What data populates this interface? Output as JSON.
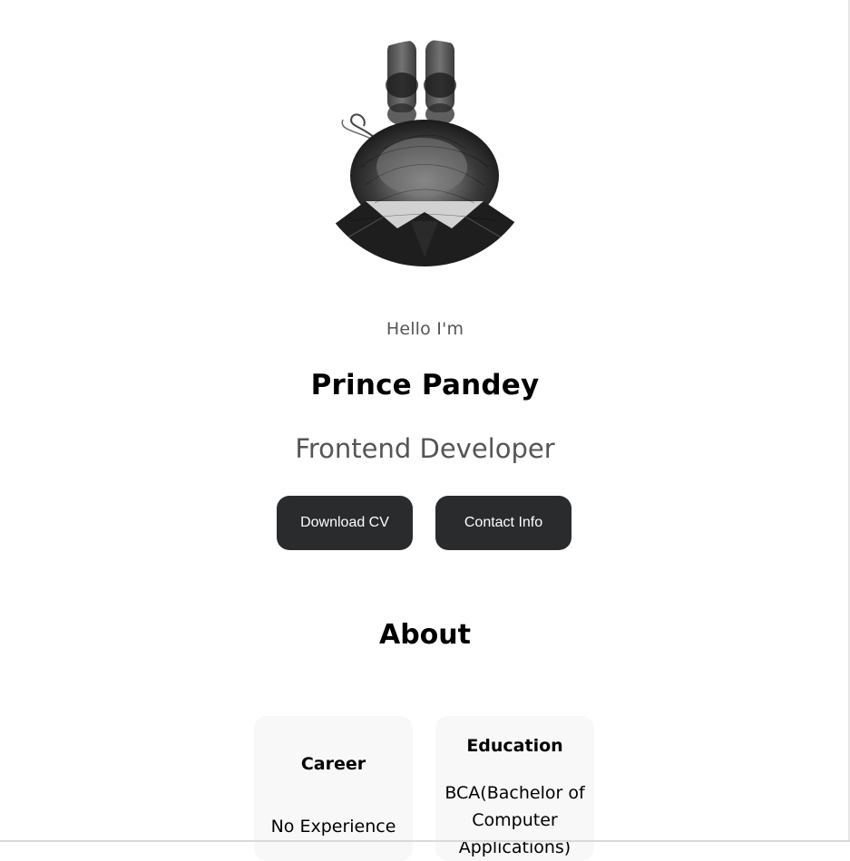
{
  "hero": {
    "greeting": "Hello I'm",
    "name": "Prince Pandey",
    "role": "Frontend Developer",
    "buttons": {
      "download_cv": "Download CV",
      "contact_info": "Contact Info"
    }
  },
  "about": {
    "title": "About",
    "cards": [
      {
        "title": "Career",
        "text": "No Experience"
      },
      {
        "title": "Education",
        "text": "BCA(Bachelor of Computer Applications)"
      }
    ]
  },
  "colors": {
    "button_bg": "#2a2b2d",
    "button_text": "#ffffff",
    "muted_text": "#555555",
    "card_bg": "#f8f8f8"
  },
  "icons": {
    "avatar": "sketch-portrait"
  }
}
